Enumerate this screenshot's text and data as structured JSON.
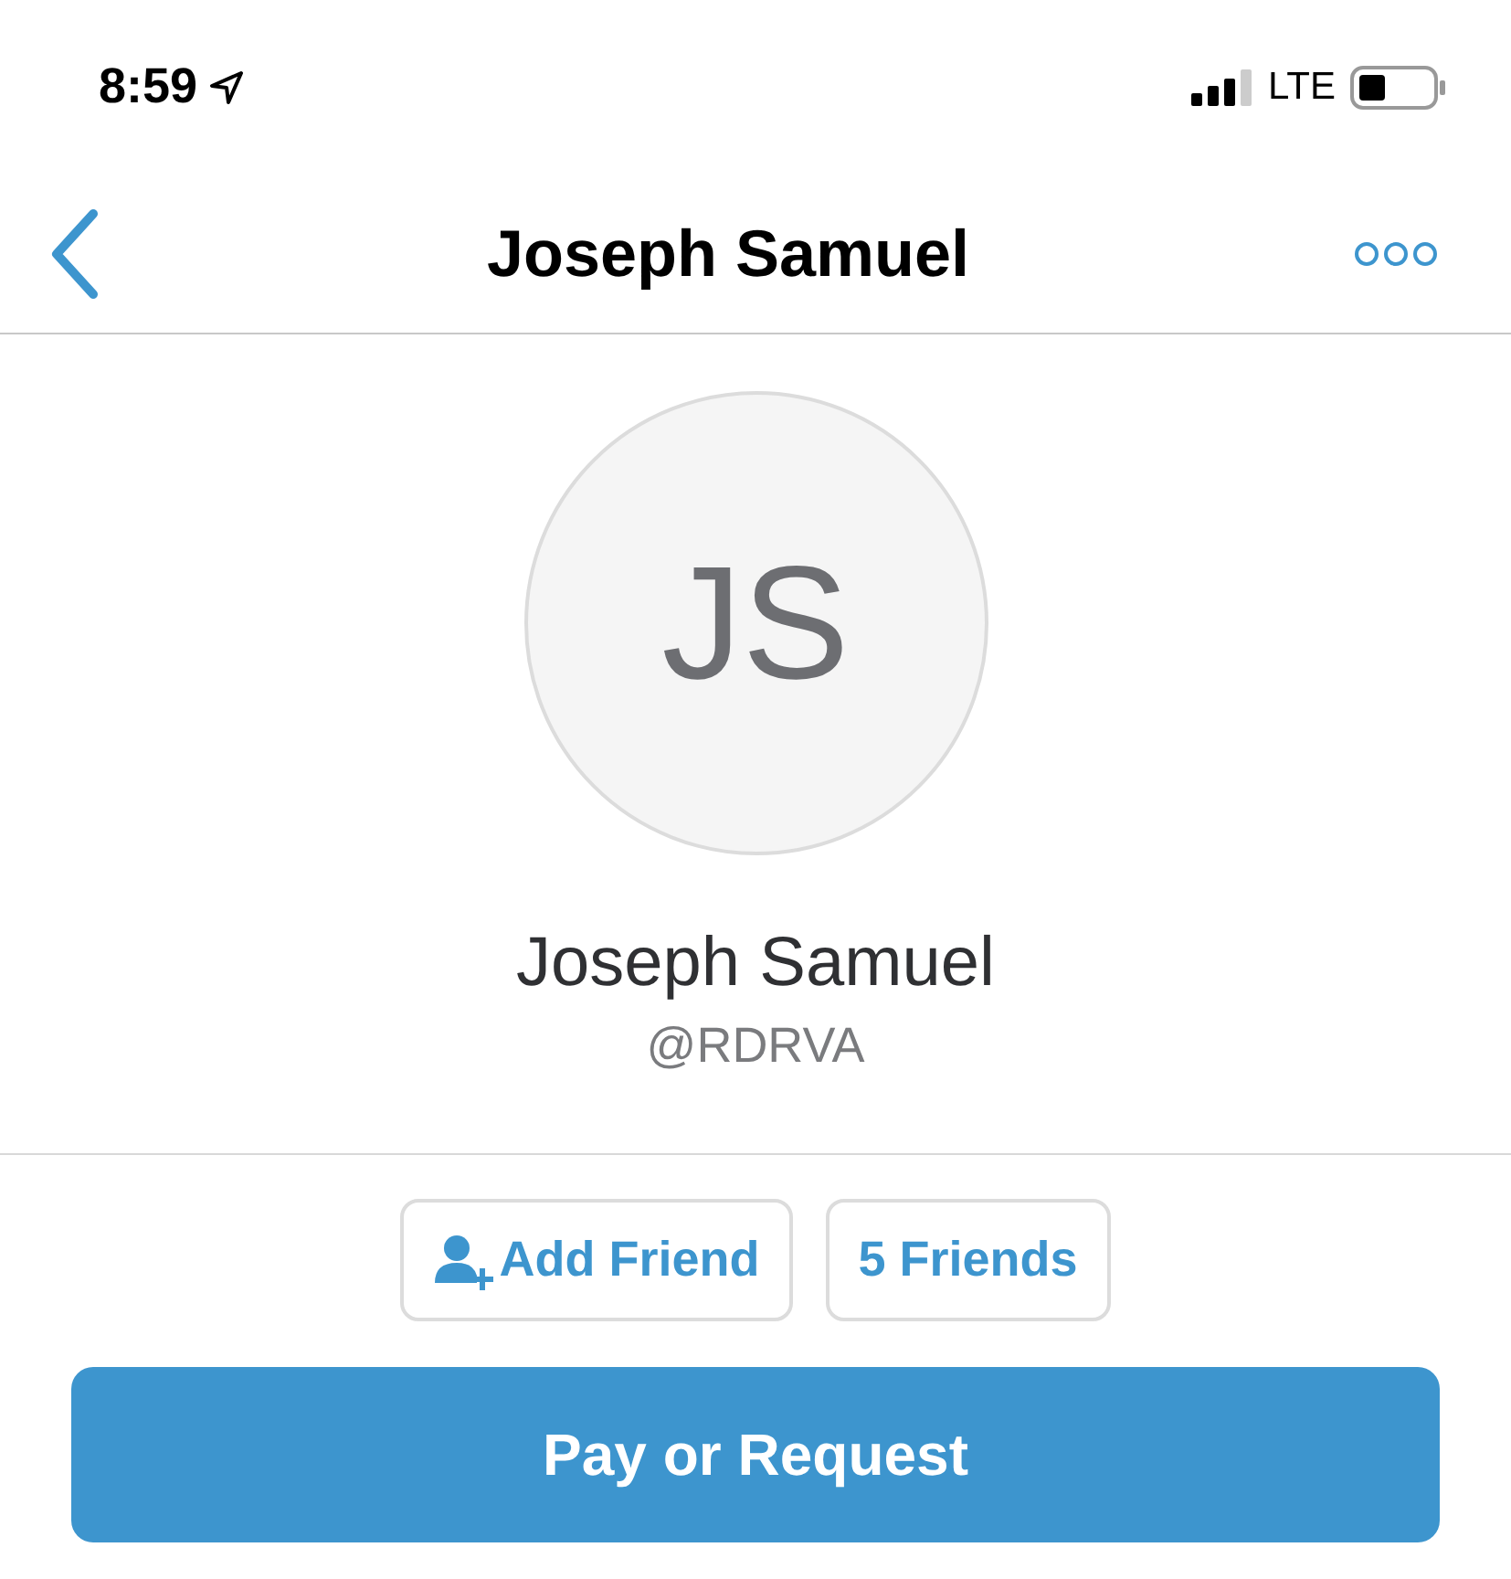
{
  "status_bar": {
    "time": "8:59",
    "network": "LTE"
  },
  "nav": {
    "title": "Joseph Samuel"
  },
  "profile": {
    "initials": "JS",
    "name": "Joseph Samuel",
    "handle": "@RDRVA"
  },
  "actions": [
    {
      "label": "Add Friend",
      "kind": "add"
    },
    {
      "label": "5 Friends",
      "kind": "count"
    }
  ],
  "primary_button": {
    "label": "Pay or Request"
  }
}
